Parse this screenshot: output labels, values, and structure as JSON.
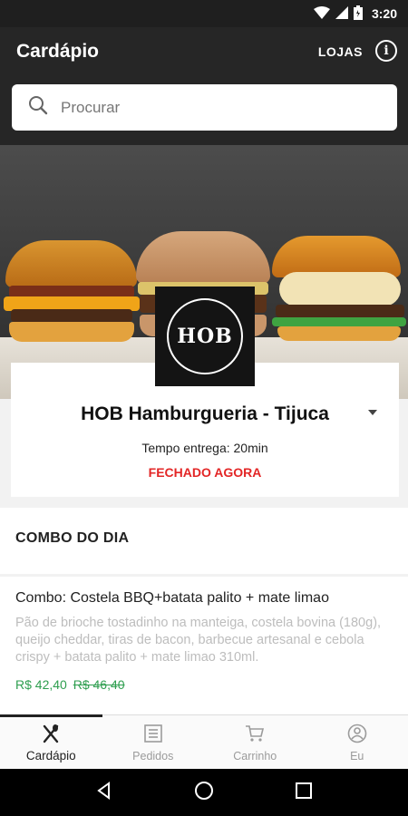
{
  "status_bar": {
    "time": "3:20"
  },
  "app_bar": {
    "title": "Cardápio",
    "lojas_label": "LOJAS",
    "info_label": "i"
  },
  "search": {
    "placeholder": "Procurar"
  },
  "store": {
    "logo_text": "HOB",
    "name": "HOB Hamburgueria - Tijuca",
    "delivery_time": "Tempo entrega: 20min",
    "status": "FECHADO AGORA"
  },
  "section": {
    "title": "COMBO DO DIA"
  },
  "item": {
    "name": "Combo: Costela BBQ+batata palito + mate limao",
    "description": "Pão de brioche tostadinho na manteiga, costela bovina (180g), queijo cheddar, tiras de bacon, barbecue artesanal e cebola crispy + batata palito + mate limao 310ml.",
    "price": "R$ 42,40",
    "old_price": "R$ 46,40"
  },
  "bottom_nav": [
    {
      "label": "Cardápio",
      "icon": "cutlery-icon",
      "active": true
    },
    {
      "label": "Pedidos",
      "icon": "receipt-icon",
      "active": false
    },
    {
      "label": "Carrinho",
      "icon": "cart-icon",
      "active": false
    },
    {
      "label": "Eu",
      "icon": "user-icon",
      "active": false
    }
  ],
  "colors": {
    "app_bar": "#262626",
    "status_closed": "#e32626",
    "price_green": "#2e9e4f"
  }
}
